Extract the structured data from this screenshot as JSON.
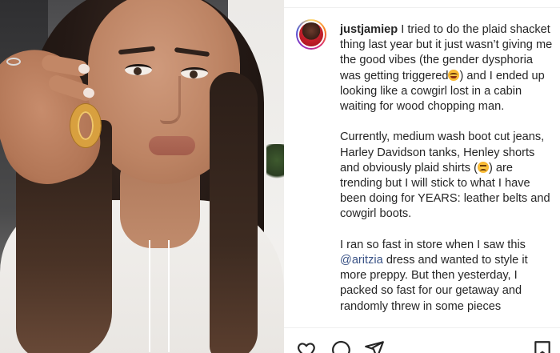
{
  "post": {
    "username": "justjamiep",
    "caption": {
      "p1_before_emoji": "I tried to do the plaid shacket thing last year but it just wasn’t giving me the good vibes (the gender dysphoria was getting triggered",
      "p1_after_emoji": ") and I ended up looking like a cowgirl lost in a cabin waiting for wood chopping man.",
      "p2_before_emoji": "Currently, medium wash boot cut jeans, Harley Davidson tanks, Henley shorts and obviously plaid shirts (",
      "p2_after_emoji": ") are trending but I will stick to what I have been doing for YEARS: leather belts and cowgirl boots.",
      "p3_before_mention": "I ran so fast in store when I saw this",
      "mention": "@aritzia",
      "p3_after_mention": "dress and wanted to style it more preppy. But then yesterday, I packed so fast for our getaway and randomly threw in some pieces"
    }
  },
  "icons": {
    "like": "heart-icon",
    "comment": "comment-bubble-icon",
    "share": "paper-plane-icon",
    "save": "bookmark-icon"
  },
  "colors": {
    "text": "#262626",
    "mention": "#385185",
    "divider": "#efefef"
  }
}
